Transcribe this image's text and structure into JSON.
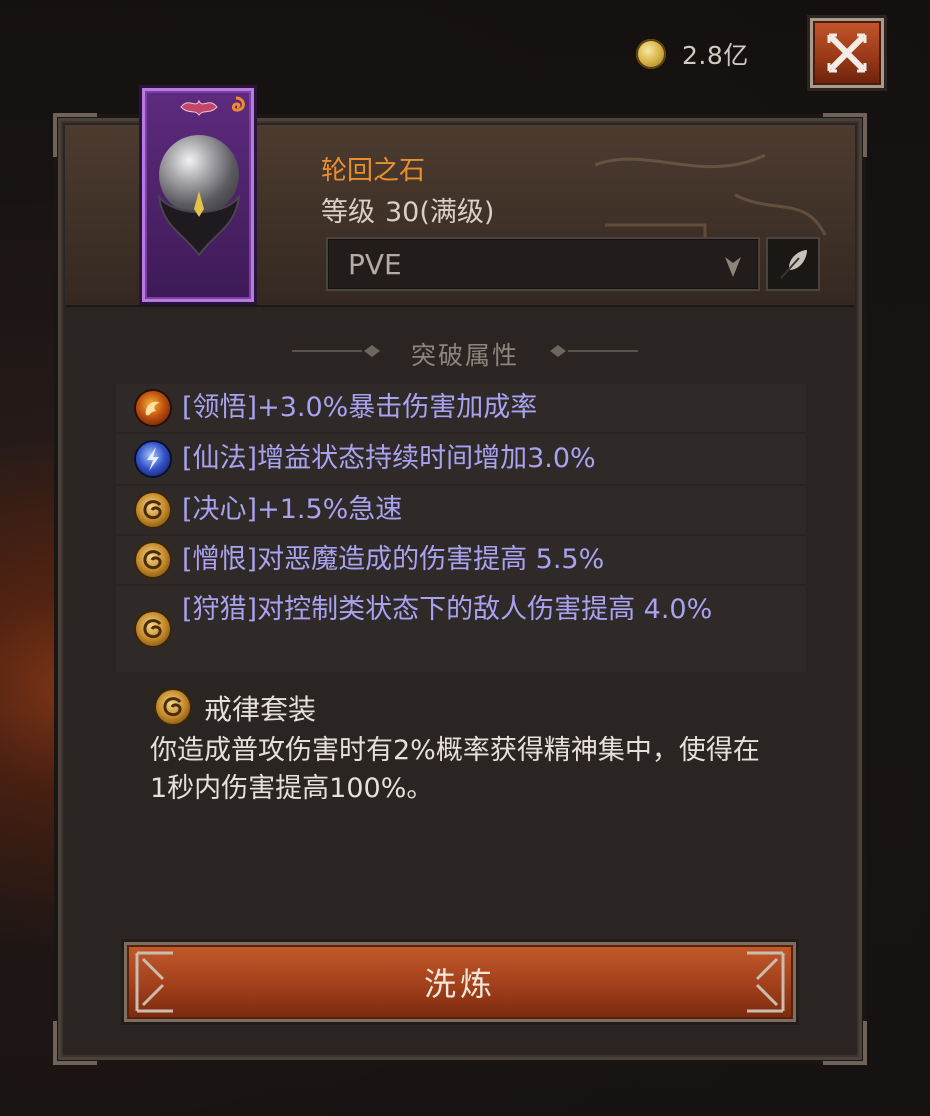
{
  "currency": {
    "amount": "2.8亿",
    "icon": "gold-coin-icon"
  },
  "close_button": {
    "icon": "close-x-icon"
  },
  "item": {
    "name": "轮回之石",
    "level_label": "等级",
    "level_value": "30(满级)",
    "rarity_color": "#8e44c9"
  },
  "mode_select": {
    "value": "PVE"
  },
  "edit_button": {
    "icon": "feather-quill-icon"
  },
  "section": {
    "title": "突破属性"
  },
  "attributes": [
    {
      "icon": "fire-swirl-icon",
      "text": "[领悟]+3.0%暴击伤害加成率"
    },
    {
      "icon": "lightning-icon",
      "text": "[仙法]增益状态持续时间增加3.0%"
    },
    {
      "icon": "gold-spiral-icon",
      "text": "[决心]+1.5%急速"
    },
    {
      "icon": "gold-spiral-icon",
      "text": "[憎恨]对恶魔造成的伤害提高 5.5%"
    },
    {
      "icon": "gold-spiral-icon",
      "text": "[狩猎]对控制类状态下的敌人伤害提高 4.0%"
    }
  ],
  "set_bonus": {
    "icon": "gold-spiral-icon",
    "name": "戒律套装",
    "description": "你造成普攻伤害时有2%概率获得精神集中，使得在1秒内伤害提高100%。"
  },
  "refine_button": {
    "label": "洗炼"
  },
  "colors": {
    "attribute_text": "#a9a2f0",
    "item_name": "#e8902e",
    "button": "#a5421c"
  }
}
